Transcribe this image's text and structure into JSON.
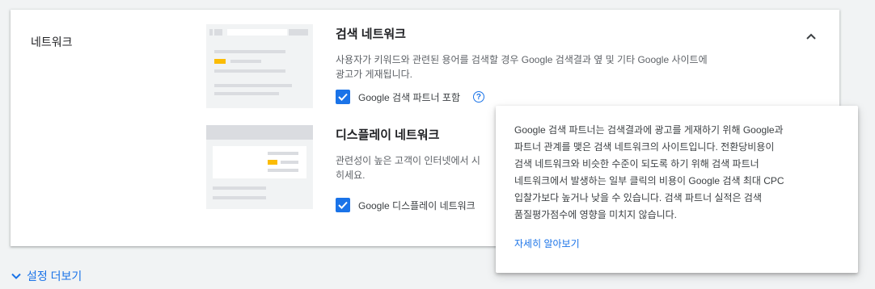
{
  "section": {
    "label": "네트워크"
  },
  "search_network": {
    "title": "검색 네트워크",
    "description_line1": "사용자가 키워드와 관련된 용어를 검색할 경우 Google 검색결과 옆 및 기타 Google 사이트에",
    "description_line2": "광고가 게재됩니다.",
    "checkbox_label": "Google 검색 파트너 포함",
    "checked": true
  },
  "display_network": {
    "title": "디스플레이 네트워크",
    "description_line1": "관련성이 높은 고객이 인터넷에서 시",
    "description_line2": "히세요.",
    "checkbox_label": "Google 디스플레이 네트워크",
    "checked": true
  },
  "tooltip": {
    "lines": [
      "Google 검색 파트너는 검색결과에 광고를 게재하기 위해 Google과",
      "파트너 관계를 맺은 검색 네트워크의 사이트입니다. 전환당비용이",
      "검색 네트워크와 비슷한 수준이 되도록 하기 위해 검색 파트너",
      "네트워크에서 발생하는 일부 클릭의 비용이 Google 검색 최대 CPC",
      "입찰가보다 높거나 낮을 수 있습니다. 검색 파트너 실적은 검색",
      "품질평가점수에 영향을 미치지 않습니다."
    ],
    "link": "자세히 알아보기"
  },
  "footer": {
    "more_settings": "설정 더보기"
  },
  "icons": {
    "collapse": "chevron-up-icon",
    "expand": "chevron-down-icon",
    "help": "help-icon",
    "check": "check-icon"
  },
  "colors": {
    "accent": "#1a73e8",
    "highlight": "#fbbc04",
    "placeholder": "#dadce0"
  }
}
